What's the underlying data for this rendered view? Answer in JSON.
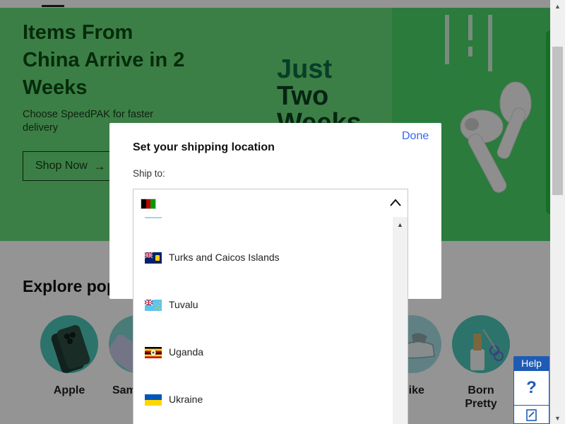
{
  "hero": {
    "title": "Items From China Arrive in 2 Weeks",
    "subtitle": "Choose SpeedPAK for faster delivery",
    "cta_label": "Shop Now",
    "cta_arrow": "→",
    "art_line1": "Just",
    "art_line2": "Two",
    "art_line3": "Weeks"
  },
  "explore": {
    "title": "Explore popular brands",
    "items": [
      {
        "label": "Apple"
      },
      {
        "label": "Samsung"
      },
      {
        "label": "Nike"
      },
      {
        "label": "Born Pretty"
      }
    ]
  },
  "modal": {
    "done_label": "Done",
    "title": "Set your shipping location",
    "ship_to_label": "Ship to:",
    "selected_country_flag": "flag-afghanistan"
  },
  "country_list": [
    {
      "name": "Turks and Caicos Islands",
      "flag": "flag-turks-caicos"
    },
    {
      "name": "Tuvalu",
      "flag": "flag-tuvalu"
    },
    {
      "name": "Uganda",
      "flag": "flag-uganda"
    },
    {
      "name": "Ukraine",
      "flag": "flag-ukraine"
    }
  ],
  "help": {
    "label": "Help",
    "question_icon": "?",
    "feedback_icon": "feedback-icon"
  },
  "colors": {
    "accent_blue": "#3665f3",
    "help_blue": "#1f5bb5",
    "hero_green": "#7fe08a",
    "hero_title": "#0a4a14"
  }
}
